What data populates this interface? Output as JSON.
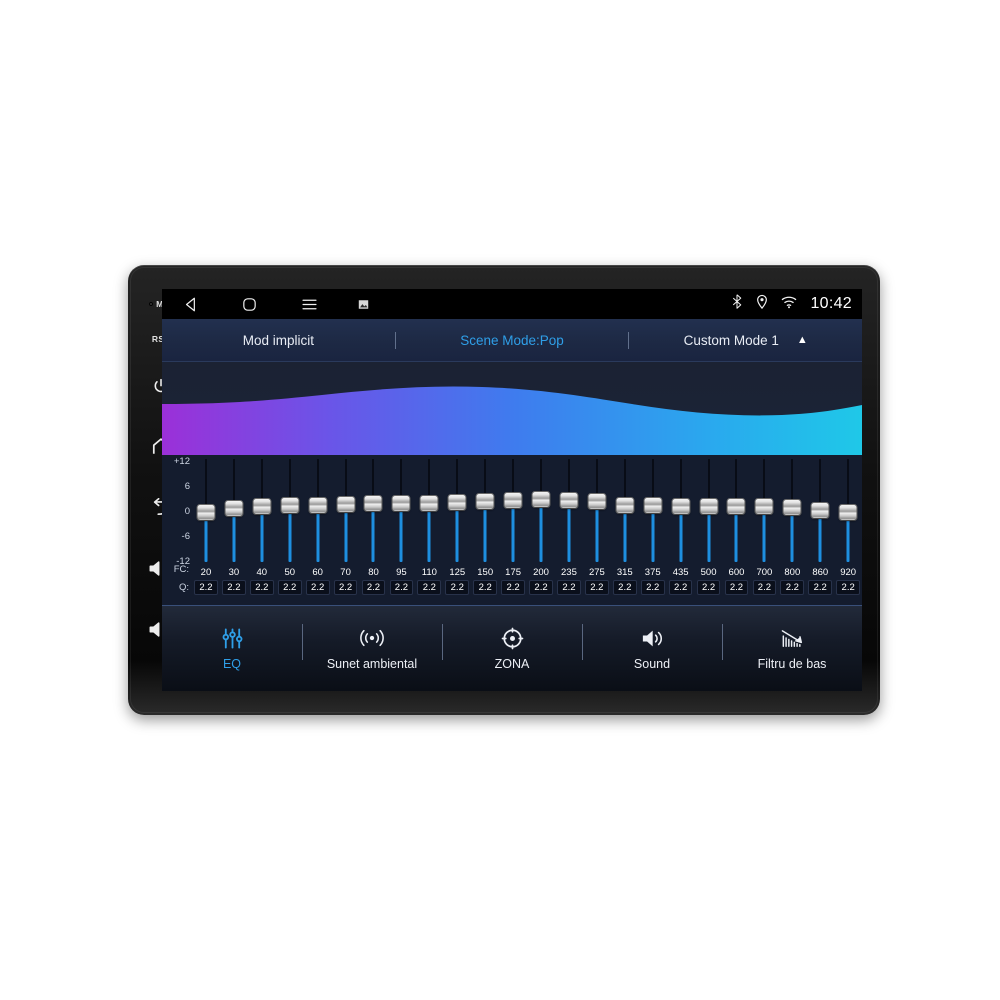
{
  "statusbar": {
    "nav": [
      {
        "name": "back-icon",
        "label": "back"
      },
      {
        "name": "home-icon",
        "label": "home"
      },
      {
        "name": "menu-icon",
        "label": "menu"
      },
      {
        "name": "screenshot-icon",
        "label": "screenshot"
      }
    ],
    "icons": [
      "bluetooth-icon",
      "location-icon",
      "wifi-icon"
    ],
    "clock": "10:42"
  },
  "mode_bar": {
    "left_label": "Mod implicit",
    "center_label": "Scene Mode:Pop",
    "right_label": "Custom Mode 1",
    "caret": "▲",
    "accent_color": "#2f9fe8"
  },
  "wave": {
    "gradient_stops": [
      "#9b30d8",
      "#6a55e8",
      "#3f7bee",
      "#2aa8ee",
      "#1fc8e8"
    ]
  },
  "equalizer": {
    "axis_labels": [
      "+12",
      "6",
      "0",
      "-6",
      "-12"
    ],
    "fc_label": "FC:",
    "q_label": "Q:",
    "range_db": [
      -12,
      12
    ],
    "bands": [
      {
        "fc": "20",
        "q": "2.2",
        "gain": -0.6
      },
      {
        "fc": "30",
        "q": "2.2",
        "gain": 0.5
      },
      {
        "fc": "40",
        "q": "2.2",
        "gain": 1.0
      },
      {
        "fc": "50",
        "q": "2.2",
        "gain": 1.5
      },
      {
        "fc": "60",
        "q": "2.2",
        "gain": 1.5
      },
      {
        "fc": "70",
        "q": "2.2",
        "gain": 1.6
      },
      {
        "fc": "80",
        "q": "2.2",
        "gain": 1.8
      },
      {
        "fc": "95",
        "q": "2.2",
        "gain": 1.9
      },
      {
        "fc": "110",
        "q": "2.2",
        "gain": 2.0
      },
      {
        "fc": "125",
        "q": "2.2",
        "gain": 2.3
      },
      {
        "fc": "150",
        "q": "2.2",
        "gain": 2.5
      },
      {
        "fc": "175",
        "q": "2.2",
        "gain": 2.6
      },
      {
        "fc": "200",
        "q": "2.2",
        "gain": 3.0
      },
      {
        "fc": "235",
        "q": "2.2",
        "gain": 2.7
      },
      {
        "fc": "275",
        "q": "2.2",
        "gain": 2.4
      },
      {
        "fc": "315",
        "q": "2.2",
        "gain": 1.5
      },
      {
        "fc": "375",
        "q": "2.2",
        "gain": 1.4
      },
      {
        "fc": "435",
        "q": "2.2",
        "gain": 1.2
      },
      {
        "fc": "500",
        "q": "2.2",
        "gain": 1.1
      },
      {
        "fc": "600",
        "q": "2.2",
        "gain": 1.0
      },
      {
        "fc": "700",
        "q": "2.2",
        "gain": 1.0
      },
      {
        "fc": "800",
        "q": "2.2",
        "gain": 0.9
      },
      {
        "fc": "860",
        "q": "2.2",
        "gain": 0.1
      },
      {
        "fc": "920",
        "q": "2.2",
        "gain": -0.5
      }
    ]
  },
  "tabs": [
    {
      "label": "EQ",
      "icon": "equalizer-sliders-icon",
      "active": true
    },
    {
      "label": "Sunet ambiental",
      "icon": "surround-sound-icon",
      "active": false
    },
    {
      "label": "ZONA",
      "icon": "zone-target-icon",
      "active": false
    },
    {
      "label": "Sound",
      "icon": "speaker-icon",
      "active": false
    },
    {
      "label": "Filtru de bas",
      "icon": "bass-filter-icon",
      "active": false
    }
  ],
  "bezel": {
    "buttons": [
      {
        "name": "mic-label",
        "label": "MIC"
      },
      {
        "name": "rst-label",
        "label": "RST"
      },
      {
        "name": "power-icon",
        "label": ""
      },
      {
        "name": "home-icon",
        "label": ""
      },
      {
        "name": "back-icon",
        "label": ""
      },
      {
        "name": "volume-up-icon",
        "label": ""
      },
      {
        "name": "volume-down-icon",
        "label": ""
      }
    ]
  }
}
